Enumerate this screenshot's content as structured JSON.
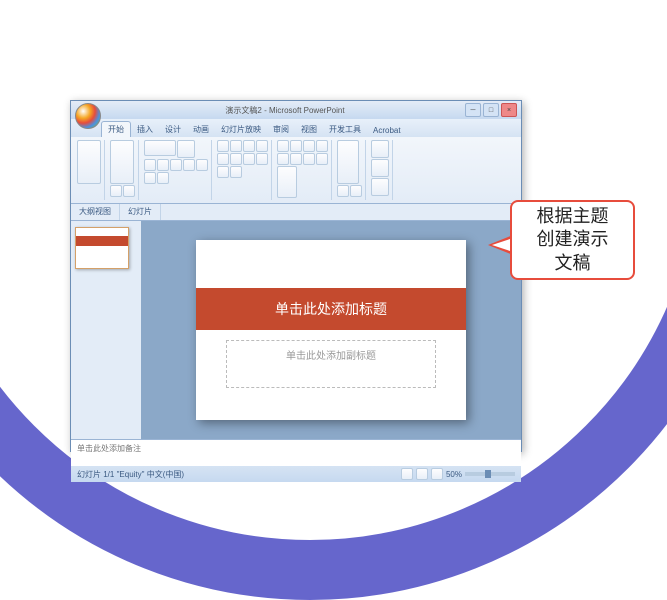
{
  "window": {
    "title": "演示文稿2 - Microsoft PowerPoint",
    "controls": {
      "min": "─",
      "max": "□",
      "close": "×"
    }
  },
  "tabs": {
    "items": [
      "开始",
      "插入",
      "设计",
      "动画",
      "幻灯片放映",
      "审阅",
      "视图",
      "开发工具",
      "Acrobat"
    ],
    "active": 0
  },
  "sub_tabs": [
    "大纲视图",
    "幻灯片"
  ],
  "slide": {
    "title_placeholder": "单击此处添加标题",
    "subtitle_placeholder": "单击此处添加副标题"
  },
  "notes": {
    "placeholder": "单击此处添加备注"
  },
  "status": {
    "left": "幻灯片 1/1  \"Equity\"  中文(中国)",
    "zoom": "50%"
  },
  "callout": {
    "text": "根据主题\n创建演示\n文稿"
  }
}
